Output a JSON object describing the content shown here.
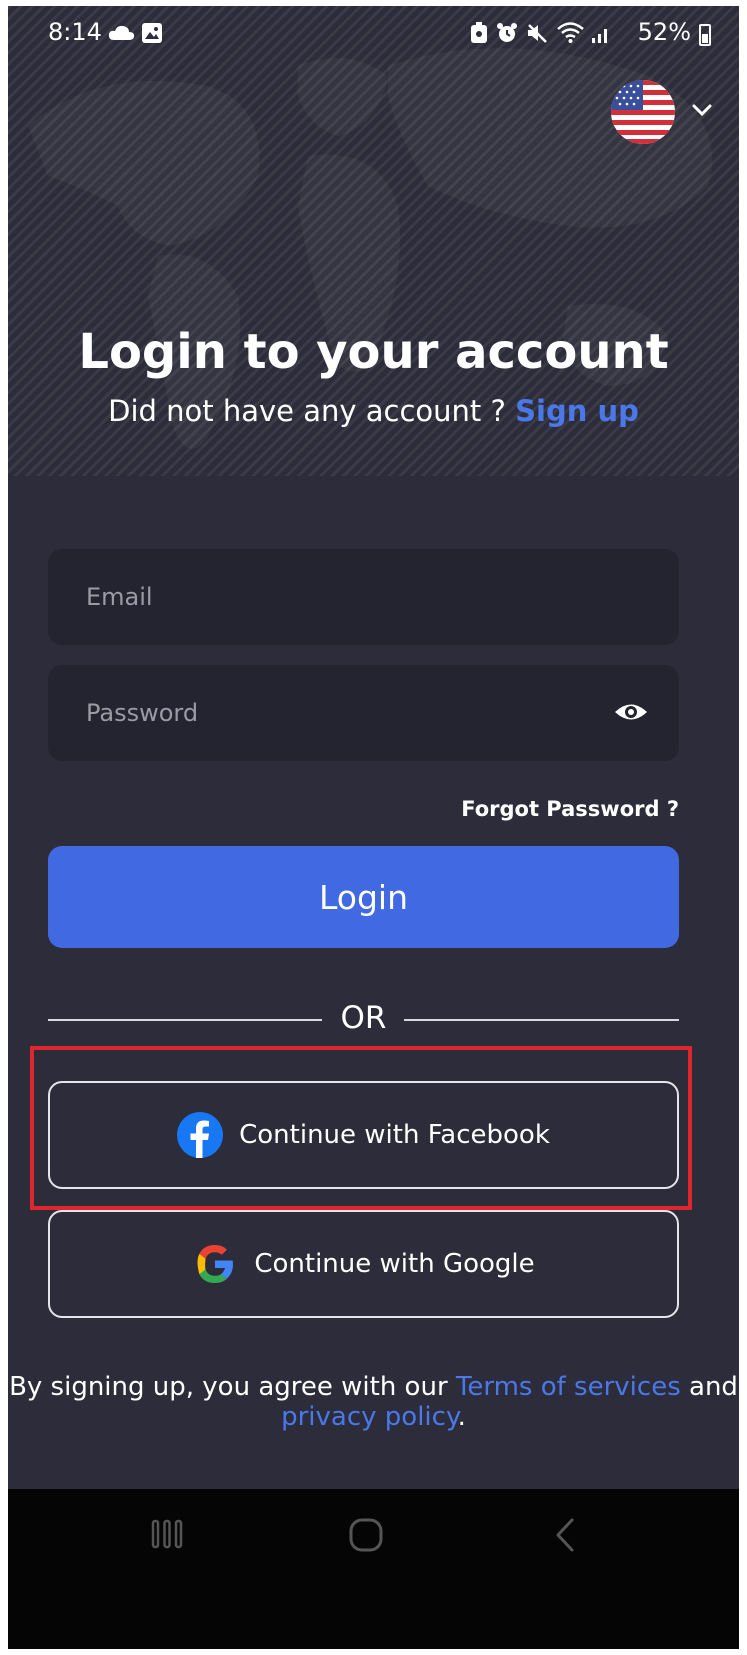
{
  "status_bar": {
    "time": "8:14",
    "battery": "52%"
  },
  "language_selector": {
    "flag_icon": "us-flag-icon",
    "chevron_icon": "chevron-down-icon"
  },
  "header": {
    "title": "Login to your account",
    "subtitle": "Did not have any account ?",
    "signup_link": "Sign up"
  },
  "form": {
    "email_placeholder": "Email",
    "password_placeholder": "Password",
    "forgot_password": "Forgot Password ?",
    "login_button": "Login"
  },
  "divider": {
    "label": "OR"
  },
  "social": {
    "facebook_label": "Continue with Facebook",
    "google_label": "Continue with Google"
  },
  "terms": {
    "prefix": "By signing up, you agree with our",
    "terms_link": "Terms of services",
    "and": "and",
    "privacy_link": "privacy policy",
    "suffix": "."
  },
  "colors": {
    "background": "#2c2c3a",
    "field_background": "#242430",
    "accent": "#4169e1",
    "link": "#4b78e8",
    "highlight_box": "#e0262d"
  }
}
